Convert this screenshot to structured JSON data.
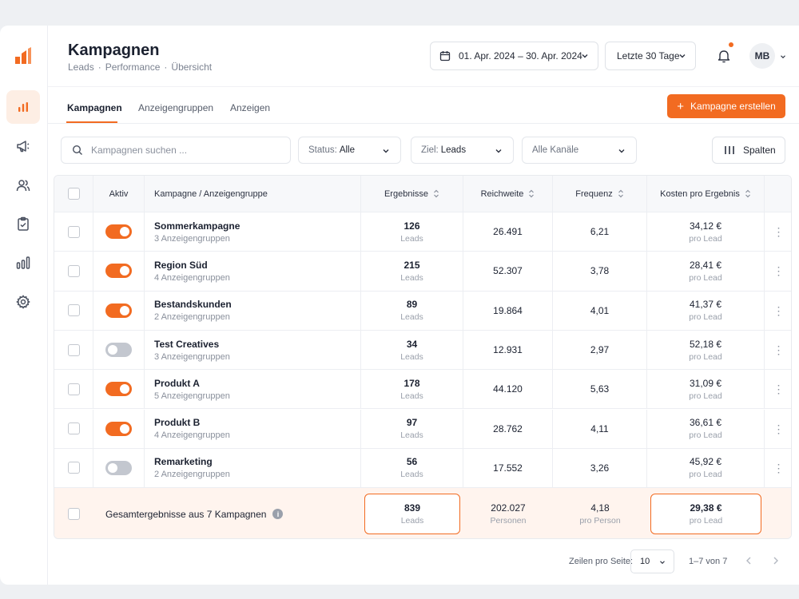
{
  "header": {
    "title": "Kampagnen",
    "breadcrumb": [
      "Leads",
      "Performance",
      "Übersicht"
    ],
    "breadcrumb_sep": "·",
    "date_range": "01. Apr. 2024 – 30. Apr. 2024",
    "period": "Letzte 30 Tage",
    "avatar_initials": "MB"
  },
  "tabs": [
    {
      "label": "Kampagnen",
      "active": true
    },
    {
      "label": "Anzeigengruppen",
      "active": false
    },
    {
      "label": "Anzeigen",
      "active": false
    }
  ],
  "create_button": "Kampagne erstellen",
  "filters": {
    "search_placeholder": "Kampagnen suchen ...",
    "status_label": "Status:",
    "status_value": "Alle",
    "goal_label": "Ziel:",
    "goal_value": "Leads",
    "channels_value": "Alle Kanäle",
    "columns_button": "Spalten"
  },
  "table": {
    "headers": {
      "active": "Aktiv",
      "campaign": "Kampagne / Anzeigengruppe",
      "results": "Ergebnisse",
      "reach": "Reichweite",
      "frequency": "Frequenz",
      "cost": "Kosten pro Ergebnis"
    },
    "rows": [
      {
        "name": "Sommerkampagne",
        "groups": "3 Anzeigengruppen",
        "active": true,
        "results": "126",
        "results_unit": "Leads",
        "reach": "26.491",
        "frequency": "6,21",
        "cost": "34,12 €",
        "cost_unit": "pro Lead"
      },
      {
        "name": "Region Süd",
        "groups": "4 Anzeigengruppen",
        "active": true,
        "results": "215",
        "results_unit": "Leads",
        "reach": "52.307",
        "frequency": "3,78",
        "cost": "28,41 €",
        "cost_unit": "pro Lead"
      },
      {
        "name": "Bestandskunden",
        "groups": "2 Anzeigengruppen",
        "active": true,
        "results": "89",
        "results_unit": "Leads",
        "reach": "19.864",
        "frequency": "4,01",
        "cost": "41,37 €",
        "cost_unit": "pro Lead"
      },
      {
        "name": "Test Creatives",
        "groups": "3 Anzeigengruppen",
        "active": false,
        "results": "34",
        "results_unit": "Leads",
        "reach": "12.931",
        "frequency": "2,97",
        "cost": "52,18 €",
        "cost_unit": "pro Lead"
      },
      {
        "name": "Produkt A",
        "groups": "5 Anzeigengruppen",
        "active": true,
        "results": "178",
        "results_unit": "Leads",
        "reach": "44.120",
        "frequency": "5,63",
        "cost": "31,09 €",
        "cost_unit": "pro Lead"
      },
      {
        "name": "Produkt B",
        "groups": "4 Anzeigengruppen",
        "active": true,
        "results": "97",
        "results_unit": "Leads",
        "reach": "28.762",
        "frequency": "4,11",
        "cost": "36,61 €",
        "cost_unit": "pro Lead"
      },
      {
        "name": "Remarketing",
        "groups": "2 Anzeigengruppen",
        "active": false,
        "results": "56",
        "results_unit": "Leads",
        "reach": "17.552",
        "frequency": "3,26",
        "cost": "45,92 €",
        "cost_unit": "pro Lead"
      }
    ],
    "total": {
      "label": "Gesamtergebnisse aus 7 Kampagnen",
      "results": "839",
      "results_unit": "Leads",
      "reach": "202.027",
      "reach_unit": "Personen",
      "frequency": "4,18",
      "frequency_unit": "pro Person",
      "cost": "29,38 €",
      "cost_unit": "pro Lead"
    }
  },
  "pagination": {
    "rows_label": "Zeilen pro Seite:",
    "rows_value": "10",
    "range": "1–7 von 7"
  },
  "colors": {
    "accent": "#f26b21",
    "toggle_off": "#c3c7cf"
  }
}
